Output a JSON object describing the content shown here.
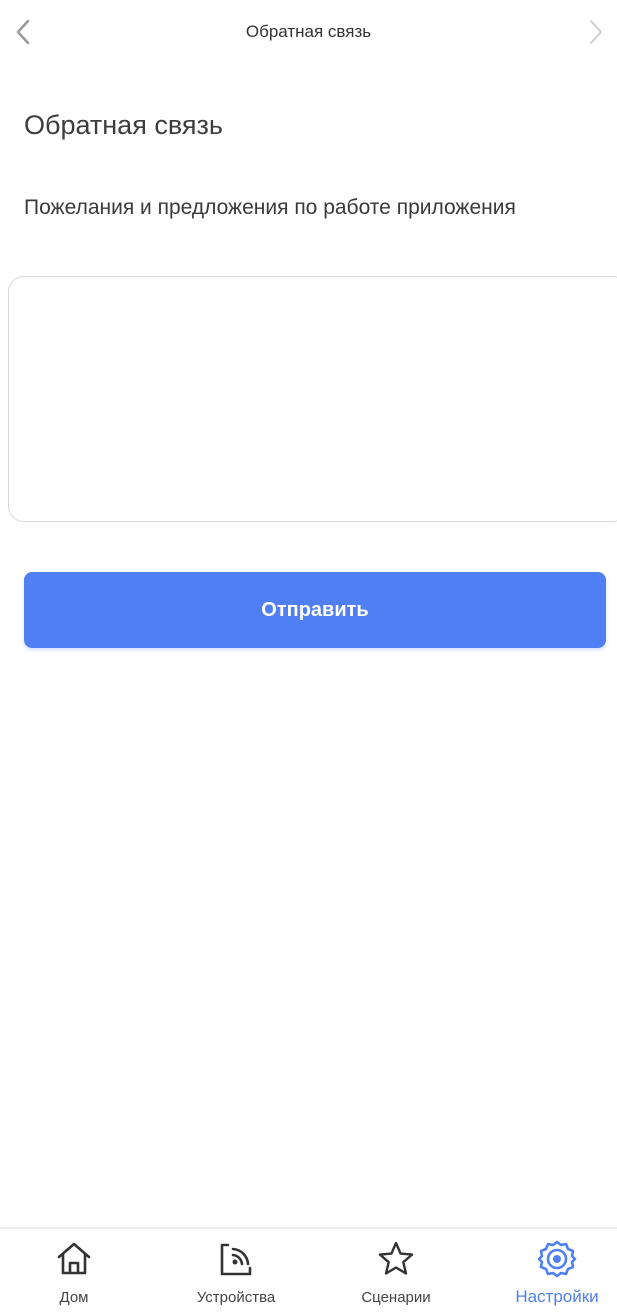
{
  "header": {
    "title": "Обратная связь",
    "back_icon": "chevron-left-icon",
    "forward_icon": "chevron-right-icon"
  },
  "main": {
    "page_title": "Обратная связь",
    "subtitle": "Пожелания и предложения по работе приложения",
    "feedback_value": "",
    "submit_label": "Отправить"
  },
  "tabbar": {
    "items": [
      {
        "label": "Дом",
        "icon": "home-icon",
        "active": false
      },
      {
        "label": "Устройства",
        "icon": "devices-icon",
        "active": false
      },
      {
        "label": "Сценарии",
        "icon": "star-icon",
        "active": false
      },
      {
        "label": "Настройки",
        "icon": "gear-icon",
        "active": true
      }
    ]
  },
  "colors": {
    "accent": "#4f7ff2",
    "text": "#3a3a3a",
    "border": "#d9d9d9"
  }
}
